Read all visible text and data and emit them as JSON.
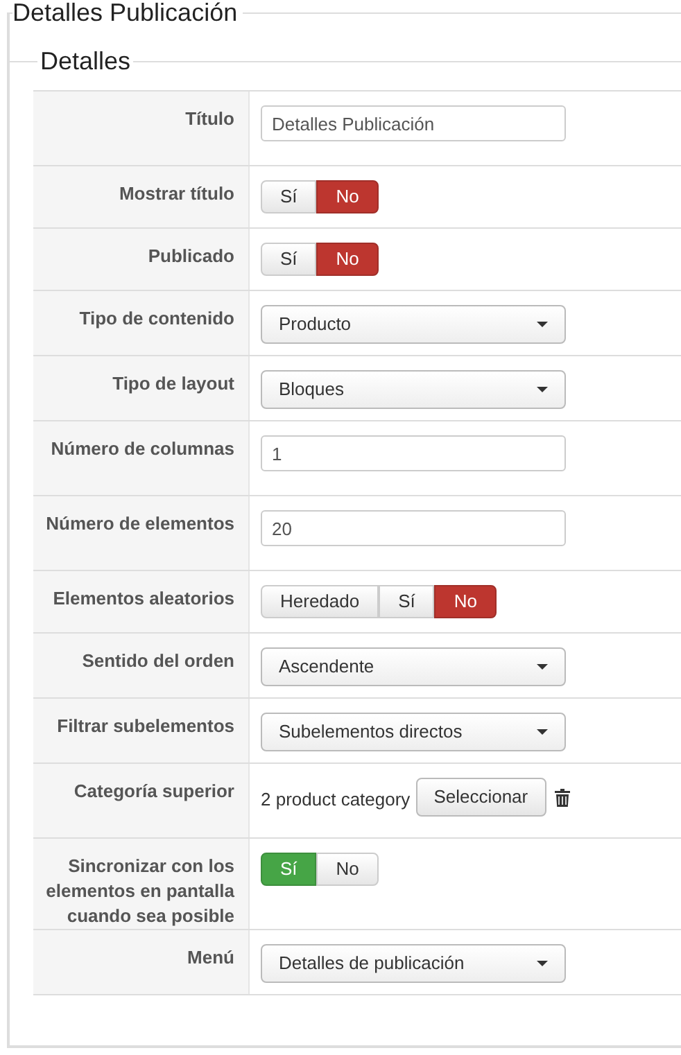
{
  "section": {
    "title": "Detalles Publicación"
  },
  "subsection": {
    "title": "Detalles"
  },
  "fields": [
    {
      "kind": "text",
      "label": "Título",
      "value": "Detalles Publicación"
    },
    {
      "kind": "toggle",
      "label": "Mostrar título",
      "options": [
        {
          "label": "Sí",
          "kind": "positive",
          "selected": false
        },
        {
          "label": "No",
          "kind": "negative",
          "selected": true
        }
      ]
    },
    {
      "kind": "toggle",
      "label": "Publicado",
      "options": [
        {
          "label": "Sí",
          "kind": "positive",
          "selected": false
        },
        {
          "label": "No",
          "kind": "negative",
          "selected": true
        }
      ]
    },
    {
      "kind": "select",
      "label": "Tipo de contenido",
      "value": "Producto"
    },
    {
      "kind": "select",
      "label": "Tipo de layout",
      "value": "Bloques"
    },
    {
      "kind": "text",
      "label": "Número de columnas",
      "value": "1"
    },
    {
      "kind": "text",
      "label": "Número de elementos",
      "value": "20"
    },
    {
      "kind": "toggle",
      "label": "Elementos aleatorios",
      "options": [
        {
          "label": "Heredado",
          "kind": "neutral",
          "selected": false
        },
        {
          "label": "Sí",
          "kind": "positive",
          "selected": false
        },
        {
          "label": "No",
          "kind": "negative",
          "selected": true
        }
      ]
    },
    {
      "kind": "select",
      "label": "Sentido del orden",
      "value": "Ascendente"
    },
    {
      "kind": "select",
      "label": "Filtrar subelementos",
      "value": "Subelementos directos"
    },
    {
      "kind": "picker",
      "label": "Categoría superior",
      "value": "2 product category",
      "button": "Seleccionar"
    },
    {
      "kind": "toggle",
      "label": "Sincronizar con los elementos en pantalla cuando sea posible",
      "options": [
        {
          "label": "Sí",
          "kind": "positive",
          "selected": true
        },
        {
          "label": "No",
          "kind": "negative",
          "selected": false
        }
      ]
    },
    {
      "kind": "select",
      "label": "Menú",
      "value": "Detalles de publicación"
    }
  ]
}
